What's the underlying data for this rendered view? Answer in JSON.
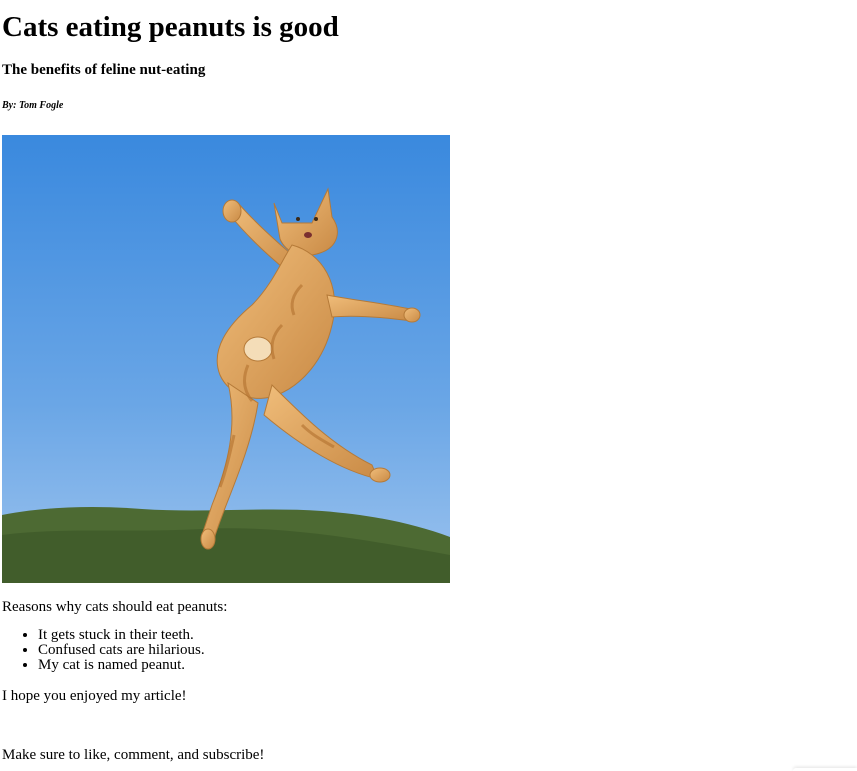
{
  "article": {
    "title": "Cats eating peanuts is good",
    "subtitle": "The benefits of feline nut-eating",
    "byline": "By: Tom Fogle",
    "image": {
      "alt_description_icon": "jumping-cat-photo",
      "colors": {
        "sky_top": "#3d8de0",
        "sky_bottom": "#8cb8ea",
        "hill": "#4f6b35",
        "cat": "#e3a45a"
      }
    },
    "intro": "Reasons why cats should eat peanuts:",
    "reasons": [
      "It gets stuck in their teeth.",
      "Confused cats are hilarious.",
      "My cat is named peanut."
    ],
    "outro": "I hope you enjoyed my article!",
    "cta": "Make sure to like, comment, and subscribe!"
  }
}
